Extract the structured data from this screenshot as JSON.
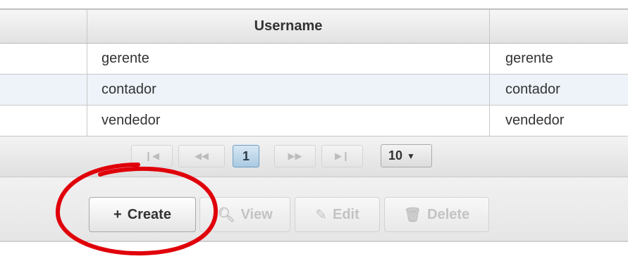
{
  "table": {
    "columns": [
      "",
      "Username",
      ""
    ],
    "rows": [
      {
        "username": "gerente",
        "other": "gerente"
      },
      {
        "username": "contador",
        "other": "contador"
      },
      {
        "username": "vendedor",
        "other": "vendedor"
      }
    ]
  },
  "paginator": {
    "first_icon": "first-page-icon",
    "prev_icon": "prev-page-icon",
    "current_page": "1",
    "next_icon": "next-page-icon",
    "last_icon": "last-page-icon",
    "rows_per_page": "10"
  },
  "toolbar": {
    "create_label": "Create",
    "view_label": "View",
    "edit_label": "Edit",
    "delete_label": "Delete"
  },
  "colors": {
    "annotation": "#e0000a",
    "selected_page": "#a9cae2",
    "alt_row": "#edf3f9"
  }
}
